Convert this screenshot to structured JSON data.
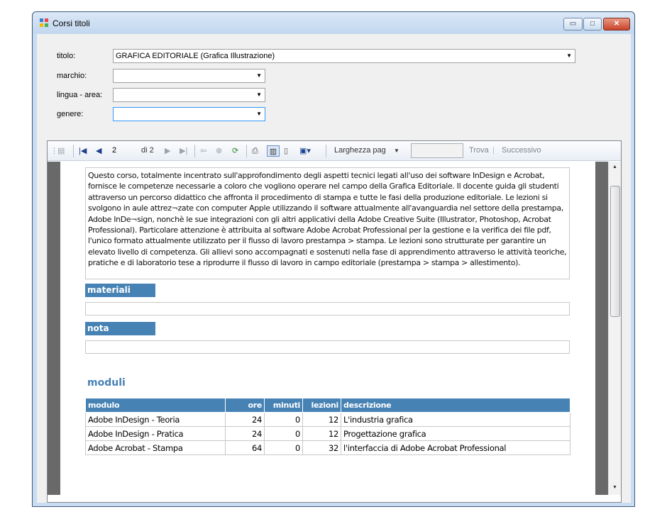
{
  "window": {
    "title": "Corsi titoli",
    "min": "▭",
    "max": "□",
    "close": "✕"
  },
  "form": {
    "titolo": {
      "label": "titolo:",
      "value": "GRAFICA EDITORIALE (Grafica Illustrazione)"
    },
    "marchio": {
      "label": "marchio:",
      "value": ""
    },
    "lingua": {
      "label": "lingua - area:",
      "value": ""
    },
    "genere": {
      "label": "genere:",
      "value": ""
    }
  },
  "toolbar": {
    "page": "2",
    "of_pages": "di 2",
    "zoom": "Larghezza pag",
    "find_value": "",
    "find": "Trova",
    "next": "Successivo"
  },
  "report": {
    "description": "Questo corso, totalmente incentrato sull'approfondimento degli aspetti tecnici legati all'uso dei software InDesign e Acrobat, fornisce le competenze necessarie a coloro che vogliono operare nel campo della Grafica Editoriale. Il docente guida gli studenti attraverso un percorso didattico che affronta il procedimento di stampa e tutte le fasi della produzione editoriale. Le lezioni si svolgono in aule attrez¬zate con computer Apple utilizzando il software attualmente all'avanguardia nel settore della prestampa, Adobe InDe¬sign, nonchè le sue integrazioni con gli altri applicativi della Adobe Creative Suite (Illustrator, Photoshop, Acrobat Professional). Particolare attenzione è attribuita al software Adobe Acrobat Professional per la gestione e la verifica dei file pdf, l'unico formato attualmente utilizzato per il flusso di lavoro prestampa > stampa. Le lezioni sono strutturate per garantire un elevato livello di competenza. Gli allievi sono accompagnati e sostenuti nella fase di apprendimento attraverso le attività teoriche, pratiche e di laboratorio tese a riprodurre il flusso di lavoro in campo editoriale (prestampa > stampa > allestimento).",
    "materiali_header": "materiali",
    "materiali_value": "",
    "nota_header": "nota",
    "nota_value": "",
    "moduli_title": "moduli",
    "columns": [
      "modulo",
      "ore",
      "minuti",
      "lezioni",
      "descrizione"
    ],
    "rows": [
      [
        "Adobe InDesign - Teoria",
        "24",
        "0",
        "12",
        "L'industria grafica"
      ],
      [
        "Adobe InDesign - Pratica",
        "24",
        "0",
        "12",
        "Progettazione grafica"
      ],
      [
        "Adobe Acrobat - Stampa",
        "64",
        "0",
        "32",
        "l'interfaccia di Adobe Acrobat Professional"
      ]
    ]
  }
}
